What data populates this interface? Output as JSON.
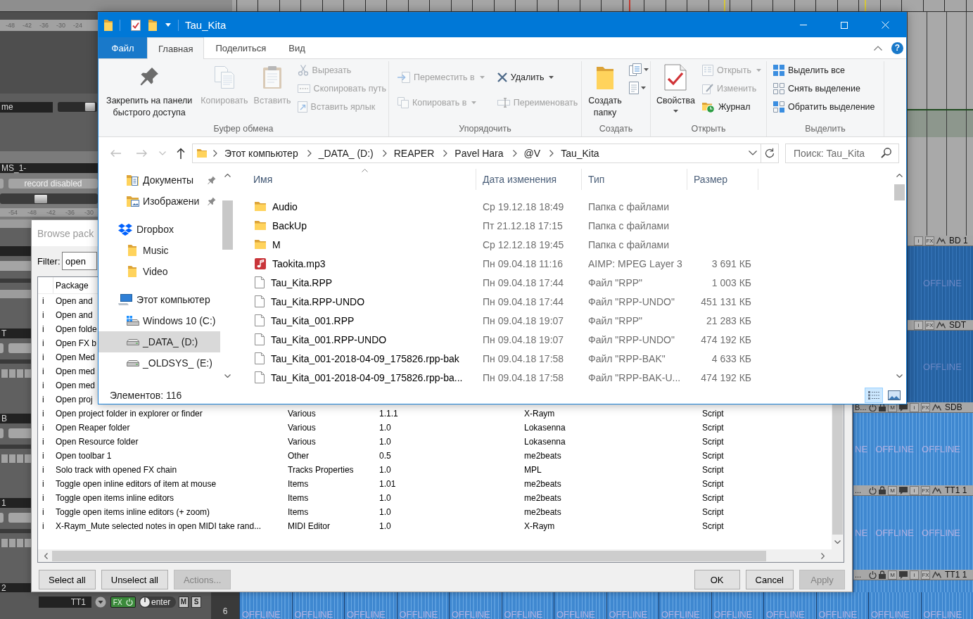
{
  "daw": {
    "top_panel": {
      "meter_scale": [
        "-48",
        "-42",
        "-36",
        "-30",
        "-24"
      ],
      "tracks": [
        {
          "kind": "compact",
          "name": "me",
          "level": 0.95
        },
        {
          "kind": "full",
          "name": "MS_1-",
          "button": "record disabled",
          "level": 0.4,
          "meter_scale": [
            "-54",
            "-48",
            "-42",
            "-36",
            "-30"
          ]
        }
      ]
    },
    "track_strip": [
      {
        "name": "T"
      },
      {
        "name": "B"
      },
      {
        "name": "1"
      },
      {
        "name": "2"
      }
    ],
    "bottom_track": {
      "name": "TT1",
      "fx_button": "FX",
      "fx_on": true,
      "knob_label": "enter",
      "buttons": [
        "M",
        "S"
      ],
      "number": "6"
    },
    "lanes": [
      {
        "kind": "cut",
        "name": "BD 1",
        "buttons": [
          "i",
          "FX"
        ],
        "labels": [
          "OFFLINE"
        ]
      },
      {
        "kind": "cut",
        "name": "SDT",
        "buttons": [
          "i",
          "FX"
        ],
        "labels": [
          "OFFLINE"
        ]
      },
      {
        "kind": "full",
        "prefix": "B...",
        "name": "SDB",
        "buttons": [
          "M",
          "i",
          "FX"
        ],
        "labels": [
          "NE",
          "OFFLINE",
          "OFFLINE"
        ]
      },
      {
        "kind": "full",
        "prefix": "...",
        "name": "TT1 1",
        "buttons": [
          "M",
          "i",
          "FX"
        ],
        "labels": [
          "NE",
          "OFFLINE",
          "OFFLINE"
        ]
      },
      {
        "kind": "bottom",
        "prefix": "...",
        "name": "TT1 1",
        "buttons": [
          "M",
          "i",
          "FX"
        ],
        "labels": [
          "OFFLINE",
          "OFFLINE",
          "OFFLINE",
          "OFFLINE",
          "OFFLINE",
          "OFFLINE",
          "OFFLINE",
          "OFFLINE",
          "OFFLINE",
          "OFFLINE",
          "OFFLINE",
          "OFFLINE",
          "OFFLINE",
          "OFFLINE"
        ]
      }
    ]
  },
  "browse_dialog": {
    "title": "Browse pack",
    "filter_label": "Filter:",
    "filter": "open",
    "columns": [
      "",
      "Package"
    ],
    "rows": [
      {
        "cells": [
          "i",
          "Open and"
        ]
      },
      {
        "cells": [
          "i",
          "Open and"
        ]
      },
      {
        "cells": [
          "i",
          "Open folde"
        ]
      },
      {
        "cells": [
          "i",
          "Open FX b"
        ]
      },
      {
        "cells": [
          "i",
          "Open Med"
        ]
      },
      {
        "cells": [
          "i",
          "Open med"
        ]
      },
      {
        "cells": [
          "i",
          "Open med"
        ]
      },
      {
        "cells": [
          "i",
          "Open proj"
        ]
      },
      {
        "cells": [
          "i",
          "Open project folder in explorer or finder",
          "Various",
          "1.1.1",
          "X-Raym",
          "Script"
        ]
      },
      {
        "cells": [
          "i",
          "Open Reaper folder",
          "Various",
          "1.0",
          "Lokasenna",
          "Script"
        ]
      },
      {
        "cells": [
          "i",
          "Open Resource folder",
          "Various",
          "1.0",
          "Lokasenna",
          "Script"
        ]
      },
      {
        "cells": [
          "i",
          "Open toolbar 1",
          "Other",
          "0.5",
          "me2beats",
          "Script"
        ]
      },
      {
        "cells": [
          "i",
          "Solo track with opened FX chain",
          "Tracks Properties",
          "1.0",
          "MPL",
          "Script"
        ]
      },
      {
        "cells": [
          "i",
          "Toggle open inline editors of item at mouse",
          "Items",
          "1.01",
          "me2beats",
          "Script"
        ]
      },
      {
        "cells": [
          "i",
          "Toggle open items inline editors",
          "Items",
          "1.0",
          "me2beats",
          "Script"
        ]
      },
      {
        "cells": [
          "i",
          "Toggle open items inline editors (+ zoom)",
          "Items",
          "1.0",
          "me2beats",
          "Script"
        ]
      },
      {
        "cells": [
          "i",
          "X-Raym_Mute selected notes in open MIDI take rand...",
          "MIDI Editor",
          "1.0",
          "X-Raym",
          "Script"
        ]
      }
    ],
    "left_buttons": [
      {
        "label": "Select all",
        "disabled": false
      },
      {
        "label": "Unselect all",
        "disabled": false
      },
      {
        "label": "Actions...",
        "disabled": true
      }
    ],
    "right_buttons": [
      {
        "label": "OK",
        "disabled": false
      },
      {
        "label": "Cancel",
        "disabled": false
      },
      {
        "label": "Apply",
        "disabled": true
      }
    ]
  },
  "explorer": {
    "title": "Tau_Kita",
    "tabs": [
      {
        "label": "Файл",
        "kind": "file",
        "selected": false
      },
      {
        "label": "Главная",
        "kind": "tab",
        "selected": true
      },
      {
        "label": "Поделиться",
        "kind": "tab",
        "selected": false
      },
      {
        "label": "Вид",
        "kind": "tab",
        "selected": false
      }
    ],
    "help": "?",
    "ribbon": [
      {
        "label": "Буфер обмена",
        "columns": [
          [
            {
              "kind": "large",
              "label": "Закрепить на панели быстрого доступа",
              "disabled": false,
              "dropdown": false
            }
          ],
          [
            {
              "kind": "large",
              "label": "Копировать",
              "disabled": true,
              "dropdown": false
            }
          ],
          [
            {
              "kind": "large",
              "label": "Вставить",
              "disabled": true,
              "dropdown": false
            }
          ],
          [
            {
              "kind": "small",
              "label": "Вырезать",
              "disabled": true,
              "dropdown": false
            },
            {
              "kind": "small",
              "label": "Скопировать путь",
              "disabled": true,
              "dropdown": false
            },
            {
              "kind": "small",
              "label": "Вставить ярлык",
              "disabled": true,
              "dropdown": false
            }
          ]
        ]
      },
      {
        "label": "Упорядочить",
        "columns": [
          [
            {
              "kind": "small",
              "label": "Переместить в",
              "disabled": true,
              "dropdown": true
            },
            {
              "kind": "small",
              "label": "Копировать в",
              "disabled": true,
              "dropdown": true
            }
          ],
          [
            {
              "kind": "small",
              "label": "Удалить",
              "disabled": false,
              "dropdown": true
            },
            {
              "kind": "small",
              "label": "Переименовать",
              "disabled": true,
              "dropdown": false
            }
          ]
        ]
      },
      {
        "label": "Создать",
        "columns": [
          [
            {
              "kind": "large",
              "label": "Создать папку",
              "disabled": false,
              "dropdown": false
            }
          ],
          [
            {
              "kind": "icon",
              "disabled": false,
              "dropdown": true
            },
            {
              "kind": "icon",
              "disabled": false,
              "dropdown": true
            }
          ]
        ]
      },
      {
        "label": "Открыть",
        "columns": [
          [
            {
              "kind": "large",
              "label": "Свойства",
              "disabled": false,
              "dropdown": true
            }
          ],
          [
            {
              "kind": "small",
              "label": "Открыть",
              "disabled": true,
              "dropdown": true
            },
            {
              "kind": "small",
              "label": "Изменить",
              "disabled": true,
              "dropdown": false
            },
            {
              "kind": "small",
              "label": "Журнал",
              "disabled": false,
              "dropdown": false
            }
          ]
        ]
      },
      {
        "label": "Выделить",
        "columns": [
          [
            {
              "kind": "small",
              "label": "Выделить все",
              "disabled": false,
              "dropdown": false
            },
            {
              "kind": "small",
              "label": "Снять выделение",
              "disabled": false,
              "dropdown": false
            },
            {
              "kind": "small",
              "label": "Обратить выделение",
              "disabled": false,
              "dropdown": false
            }
          ]
        ]
      }
    ],
    "nav_buttons": [
      {
        "disabled": true
      },
      {
        "disabled": true
      },
      {
        "disabled": true
      },
      {
        "disabled": false
      }
    ],
    "address": [
      "Этот компьютер",
      "_DATA_ (D:)",
      "REAPER",
      "Pavel Hara",
      "@V",
      "Tau_Kita"
    ],
    "search": {
      "placeholder": "Поиск: Tau_Kita"
    },
    "nav_pane": {
      "items": [
        {
          "children": [
            {
              "label": "Документы",
              "kind": "documents",
              "pinned": true,
              "selected": false
            },
            {
              "label": "Изображени",
              "kind": "pictures",
              "pinned": true,
              "selected": false
            }
          ]
        },
        {
          "label": "Dropbox",
          "kind": "cloud",
          "pinned": false,
          "selected": false,
          "children": [
            {
              "label": "Music",
              "kind": "folder",
              "pinned": false,
              "selected": false
            },
            {
              "label": "Video",
              "kind": "folder",
              "pinned": false,
              "selected": false
            }
          ]
        },
        {
          "label": "Этот компьютер",
          "kind": "computer",
          "pinned": false,
          "selected": false,
          "children": [
            {
              "label": "Windows 10 (C:)",
              "kind": "system_drive",
              "pinned": false,
              "selected": false
            },
            {
              "label": "_DATA_ (D:)",
              "kind": "drive",
              "pinned": false,
              "selected": true
            },
            {
              "label": "_OLDSYS_ (E:)",
              "kind": "drive",
              "pinned": false,
              "selected": false
            }
          ]
        }
      ]
    },
    "columns": [
      {
        "label": "Имя",
        "sorted": true
      },
      {
        "label": "Дата изменения",
        "sorted": false
      },
      {
        "label": "Тип",
        "sorted": false
      },
      {
        "label": "Размер",
        "sorted": false
      }
    ],
    "files": [
      {
        "kind": "folder",
        "name": "Audio",
        "date": "Ср 19.12.18 18:49",
        "type": "Папка с файлами"
      },
      {
        "kind": "folder",
        "name": "BackUp",
        "date": "Пт 21.12.18 17:15",
        "type": "Папка с файлами"
      },
      {
        "kind": "folder",
        "name": "M",
        "date": "Ср 12.12.18 19:45",
        "type": "Папка с файлами"
      },
      {
        "kind": "audio",
        "name": "Taokita.mp3",
        "date": "Пн 09.04.18 11:16",
        "type": "AIMP: MPEG Layer 3",
        "size": "3 691 КБ"
      },
      {
        "kind": "file",
        "name": "Tau_Kita.RPP",
        "date": "Пн 09.04.18 17:44",
        "type": "Файл \"RPP\"",
        "size": "1 003 КБ"
      },
      {
        "kind": "file",
        "name": "Tau_Kita.RPP-UNDO",
        "date": "Пн 09.04.18 17:44",
        "type": "Файл \"RPP-UNDO\"",
        "size": "451 131 КБ"
      },
      {
        "kind": "file",
        "name": "Tau_Kita_001.RPP",
        "date": "Пн 09.04.18 19:07",
        "type": "Файл \"RPP\"",
        "size": "21 283 КБ"
      },
      {
        "kind": "file",
        "name": "Tau_Kita_001.RPP-UNDO",
        "date": "Пн 09.04.18 19:07",
        "type": "Файл \"RPP-UNDO\"",
        "size": "474 192 КБ"
      },
      {
        "kind": "file",
        "name": "Tau_Kita_001-2018-04-09_175826.rpp-bak",
        "date": "Пн 09.04.18 17:58",
        "type": "Файл \"RPP-BAK\"",
        "size": "4 633 КБ"
      },
      {
        "kind": "file",
        "name": "Tau_Kita_001-2018-04-09_175826.rpp-ba...",
        "date": "Пн 09.04.18 17:58",
        "type": "Файл \"RPP-BAK-U...",
        "size": "474 192 КБ"
      }
    ],
    "status": "Элементов: 116",
    "views": [
      {
        "selected": true
      },
      {
        "selected": false
      }
    ]
  }
}
